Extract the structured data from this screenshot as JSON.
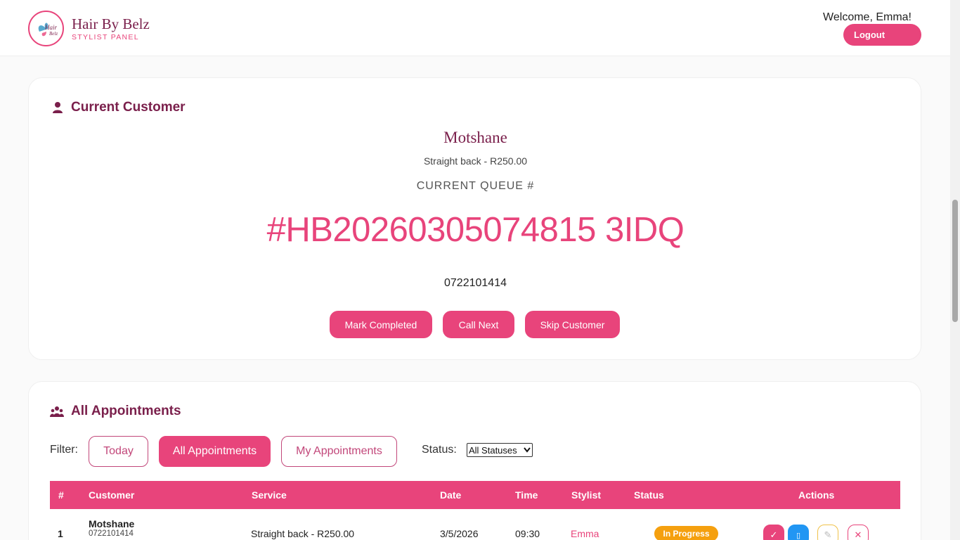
{
  "header": {
    "brand_name": "Hair By Belz",
    "brand_sub": "STYLIST PANEL",
    "welcome": "Welcome, Emma!",
    "logout_label": "Logout"
  },
  "current_customer": {
    "title": "Current Customer",
    "name": "Motshane",
    "service": "Straight back - R250.00",
    "queue_label": "CURRENT QUEUE #",
    "queue_number": "#HB20260305074815 3IDQ",
    "phone": "0722101414",
    "buttons": {
      "mark_completed": "Mark Completed",
      "call_next": "Call Next",
      "skip_customer": "Skip Customer"
    }
  },
  "appointments": {
    "title": "All Appointments",
    "filter_label": "Filter:",
    "filters": [
      "Today",
      "All Appointments",
      "My Appointments"
    ],
    "active_filter": "All Appointments",
    "status_label": "Status:",
    "status_selected": "All Statuses",
    "columns": [
      "#",
      "Customer",
      "Service",
      "Date",
      "Time",
      "Stylist",
      "Status",
      "Actions"
    ],
    "rows": [
      {
        "num": "1",
        "customer": "Motshane",
        "phone": "0722101414",
        "service": "Straight back - R250.00",
        "date": "3/5/2026",
        "time": "09:30",
        "stylist": "Emma",
        "status": "In Progress"
      }
    ]
  },
  "colors": {
    "accent": "#e8447b",
    "brand_dark": "#7a1f4b",
    "status_in_progress": "#f5a00f",
    "action_blue": "#2196f3"
  }
}
